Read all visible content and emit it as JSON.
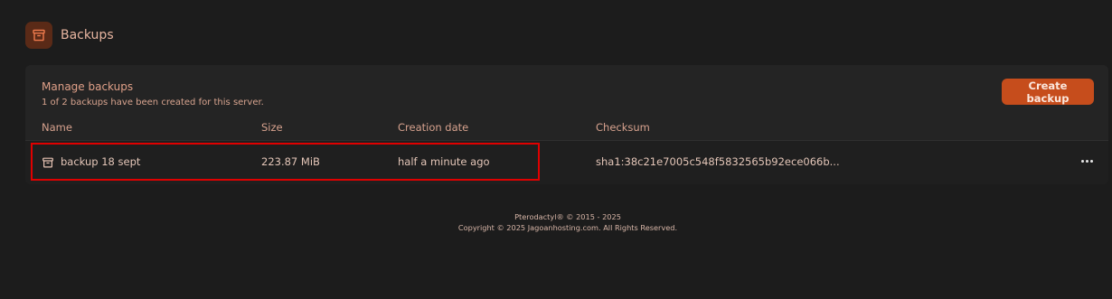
{
  "header": {
    "title": "Backups",
    "icon": "archive-icon"
  },
  "panel": {
    "title": "Manage backups",
    "subtitle": "1 of 2 backups have been created for this server.",
    "create_button_label": "Create backup"
  },
  "table": {
    "columns": [
      "Name",
      "Size",
      "Creation date",
      "Checksum"
    ],
    "rows": [
      {
        "name": "backup 18 sept",
        "size": "223.87 MiB",
        "created": "half a minute ago",
        "checksum": "sha1:38c21e7005c548f5832565b92ece066b..."
      }
    ]
  },
  "footer": {
    "line1": "Pterodactyl® © 2015 - 2025",
    "line2": "Copyright © 2025 Jagoanhosting.com. All Rights Reserved."
  },
  "colors": {
    "accent": "#c64d1c",
    "highlight": "#e00000",
    "background": "#1c1c1c",
    "panel": "#242424"
  }
}
